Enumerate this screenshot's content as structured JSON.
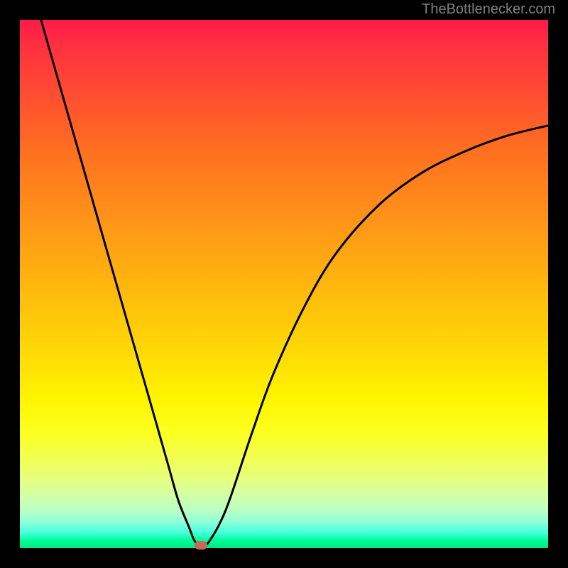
{
  "attribution": "TheBottlenecker.com",
  "chart_data": {
    "type": "line",
    "title": "",
    "xlabel": "",
    "ylabel": "",
    "xlim": [
      0,
      100
    ],
    "ylim": [
      0,
      100
    ],
    "gradient_colors": {
      "top": "#ff1a49",
      "mid": "#ffe005",
      "bottom": "#00e682"
    },
    "series": [
      {
        "name": "bottleneck-curve",
        "x": [
          4,
          8,
          12,
          16,
          20,
          24,
          28,
          30,
          32,
          33,
          34,
          35,
          36,
          38,
          40,
          44,
          48,
          54,
          60,
          68,
          76,
          84,
          92,
          100
        ],
        "y": [
          100,
          86,
          72,
          58,
          44,
          30,
          16,
          9,
          4,
          1.5,
          0.5,
          0.5,
          1.5,
          5,
          10,
          22,
          33,
          46,
          56,
          65,
          71,
          75,
          78,
          80
        ]
      }
    ],
    "marker": {
      "x": 34.3,
      "y": 0.5,
      "color": "#c96858"
    }
  }
}
